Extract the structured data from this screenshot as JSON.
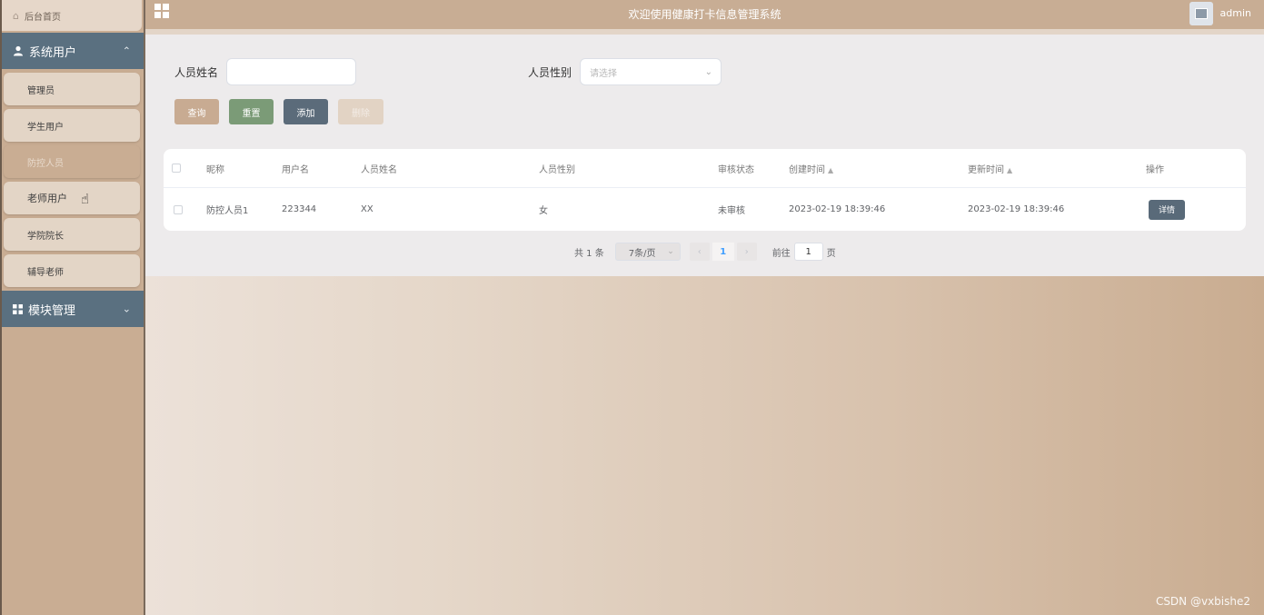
{
  "sidebar": {
    "home_label": "后台首页",
    "group1": {
      "label": "系统用户",
      "expanded": true
    },
    "items": [
      {
        "label": "管理员"
      },
      {
        "label": "学生用户"
      },
      {
        "label": "防控人员",
        "active": true
      },
      {
        "label": "老师用户"
      },
      {
        "label": "学院院长"
      },
      {
        "label": "辅导老师"
      }
    ],
    "group2": {
      "label": "模块管理",
      "expanded": false
    }
  },
  "header": {
    "title": "欢迎使用健康打卡信息管理系统",
    "username": "admin"
  },
  "search": {
    "name_label": "人员姓名",
    "name_value": "",
    "gender_label": "人员性别",
    "gender_placeholder": "请选择"
  },
  "buttons": {
    "query": "查询",
    "reset": "重置",
    "add": "添加",
    "delete": "删除"
  },
  "table": {
    "headers": [
      "昵称",
      "用户名",
      "人员姓名",
      "人员性别",
      "审核状态",
      "创建时间",
      "更新时间",
      "操作"
    ],
    "rows": [
      {
        "nickname": "防控人员1",
        "username": "223344",
        "name": "XX",
        "gender": "女",
        "status": "未审核",
        "created": "2023-02-19 18:39:46",
        "updated": "2023-02-19 18:39:46",
        "action": "详情"
      }
    ]
  },
  "pagination": {
    "total": "共 1 条",
    "page_size": "7条/页",
    "current_page": "1",
    "goto_label": "前往",
    "goto_value": "1",
    "page_unit": "页"
  },
  "watermark": "CSDN @vxbishe2",
  "colors": {
    "sidebar_bg": "#c9ad93",
    "group_header": "#5a7080",
    "btn_query": "#c8ab92",
    "btn_reset": "#7b9b77",
    "btn_add": "#5b6b7a",
    "btn_delete": "#e2d3c4"
  }
}
